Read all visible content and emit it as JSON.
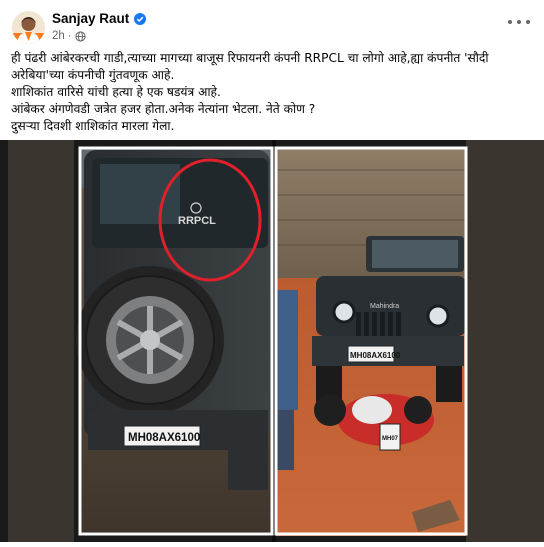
{
  "post": {
    "author": "Sanjay Raut",
    "time": "2h",
    "separator": "·",
    "text_lines": [
      "ही पंढरी आंबेरकरची गाडी,त्याच्या मागच्या बाजूस रिफायनरी कंपनी RRPCL चा लोगो आहे,ह्या कंपनीत 'सौदी",
      "अरेबिया'च्या कंपनीची गुंतवणूक आहे.",
      "शाशिकांत वारिसे यांची हत्या हे एक  षडयंत्र आहे.",
      "आंबेकर अंगणेवडी जत्रेत हजर होता.अनेक नेत्यांना  भेटला. नेते कोण ?",
      "दुसऱ्या दिवशी शाशिकांत मारला गेला."
    ]
  },
  "photos": {
    "left": {
      "logo_text": "RRPCL",
      "plate": "MH08AX6100",
      "highlight_color": "#e0202a"
    },
    "right": {
      "brand": "Mahindra",
      "plate": "MH08AX6100",
      "scooter_plate": "MH07"
    }
  },
  "colors": {
    "verified": "#1877f2",
    "meta": "#65676b"
  }
}
